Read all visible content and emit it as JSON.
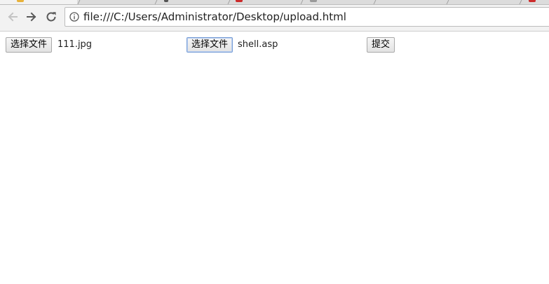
{
  "browser": {
    "url": "file:///C:/Users/Administrator/Desktop/upload.html",
    "back_icon": "arrow-left-icon",
    "forward_icon": "arrow-right-icon",
    "reload_icon": "reload-icon",
    "info_icon": "info-icon"
  },
  "form": {
    "file_input_1": {
      "button_label": "选择文件",
      "file_name": "111.jpg"
    },
    "file_input_2": {
      "button_label": "选择文件",
      "file_name": "shell.asp"
    },
    "submit_label": "提交"
  },
  "colors": {
    "chrome_bg": "#f2f2f2",
    "focus_border": "#7a9fd6"
  }
}
